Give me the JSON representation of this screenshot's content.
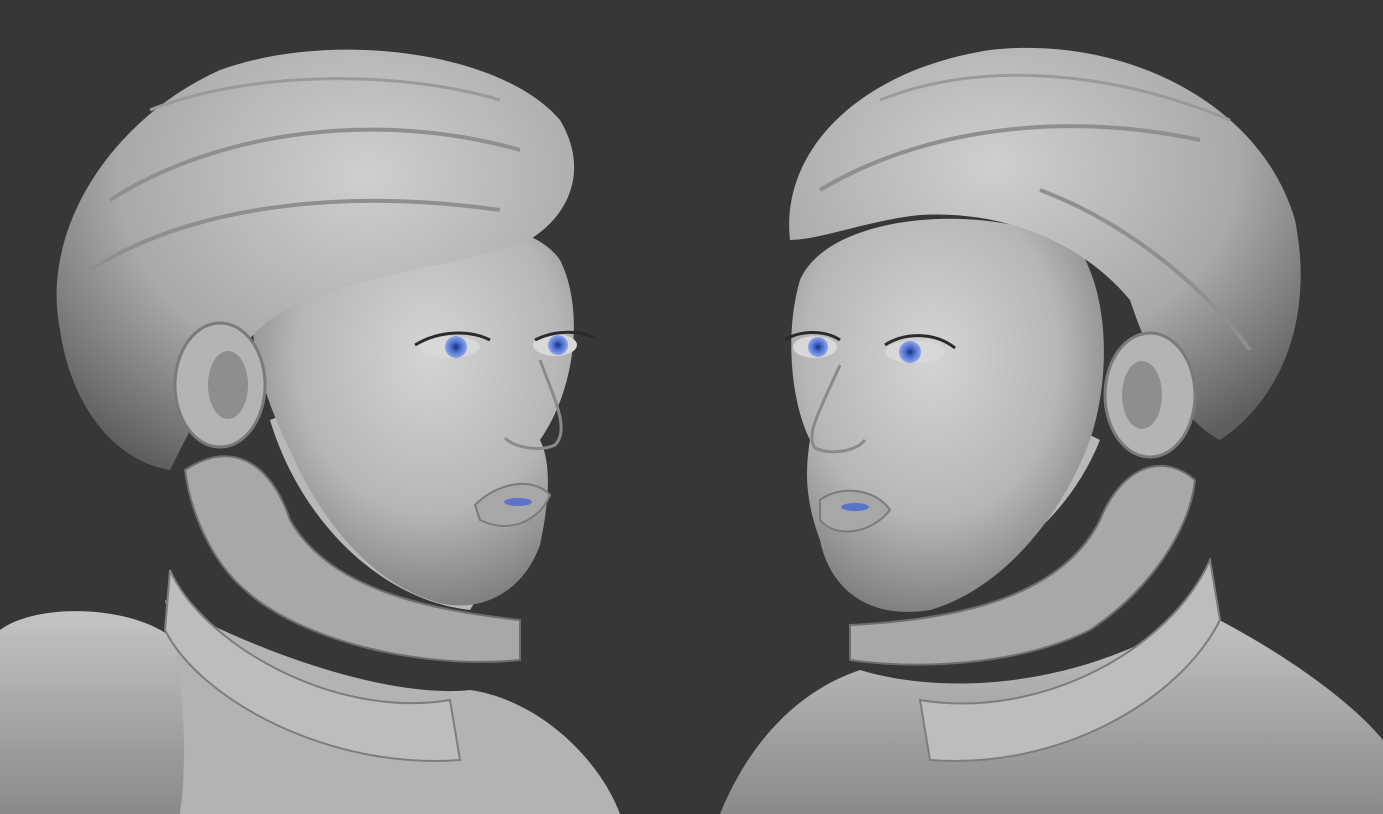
{
  "scene": {
    "description_visible_text": "",
    "background_color": "#373737",
    "clay_color": "#c8c8c8",
    "clay_shadow_color": "#6e6e6e",
    "eye_color": "#4a6fd0",
    "views": [
      {
        "view": "three-quarter",
        "facing": "right"
      },
      {
        "view": "three-quarter",
        "facing": "left"
      }
    ]
  }
}
